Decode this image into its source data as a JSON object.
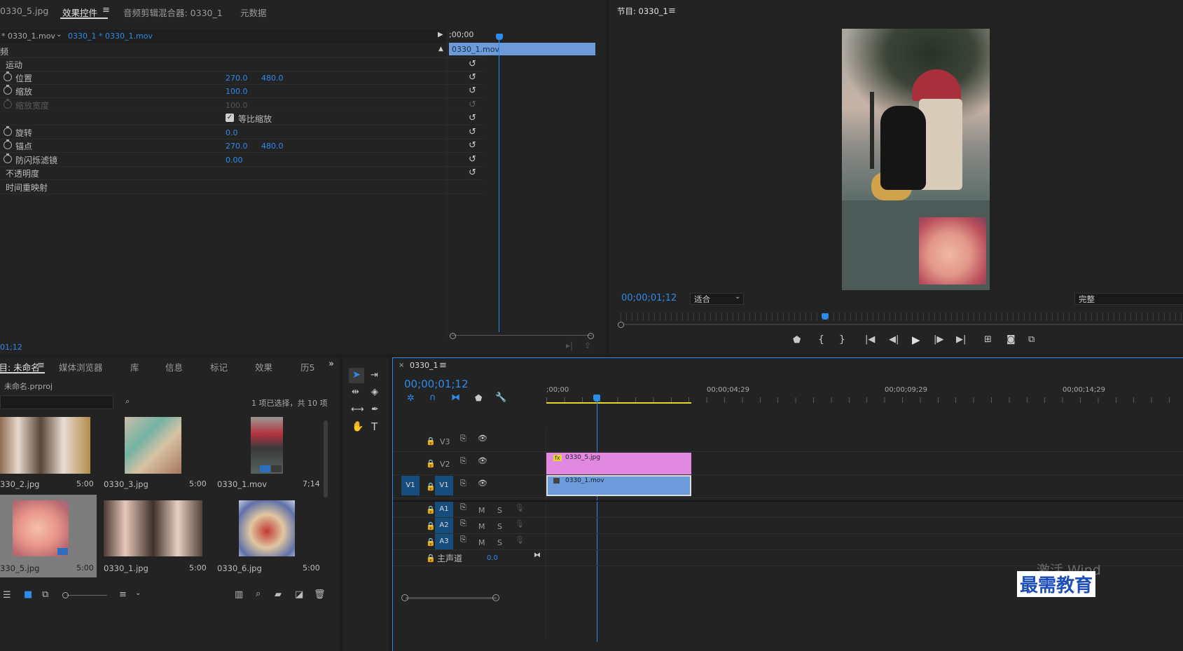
{
  "effects_panel": {
    "tabs": [
      "0330_5.jpg",
      "效果控件",
      "音频剪辑混合器: 0330_1",
      "元数据"
    ],
    "source_label": "* 0330_1.mov",
    "clip_label": "0330_1 * 0330_1.mov",
    "timecode_start": ";00;00",
    "clip_bar_label": "0330_1.mov",
    "video_header": "频",
    "motion_label": "运动",
    "properties": [
      {
        "label": "位置",
        "v1": "270.0",
        "v2": "480.0"
      },
      {
        "label": "缩放",
        "v1": "100.0",
        "v2": ""
      },
      {
        "label": "缩放宽度",
        "v1": "100.0",
        "v2": ""
      },
      {
        "label": "等比缩放",
        "v1": "",
        "v2": ""
      },
      {
        "label": "旋转",
        "v1": "0.0",
        "v2": ""
      },
      {
        "label": "锚点",
        "v1": "270.0",
        "v2": "480.0"
      },
      {
        "label": "防闪烁滤镜",
        "v1": "0.00",
        "v2": ""
      }
    ],
    "opacity_label": "不透明度",
    "time_remap_label": "时间重映射",
    "bottom_time": "01;12"
  },
  "program_monitor": {
    "title": "节目: 0330_1",
    "timecode": "00;00;01;12",
    "zoom": "适合",
    "quality": "完整"
  },
  "project_panel": {
    "tabs": [
      "项目: 未命名",
      "媒体浏览器",
      "库",
      "信息",
      "标记",
      "效果",
      "历5"
    ],
    "project_file": "未命名.prproj",
    "selection_status": "1 项已选择，共 10 项",
    "items": [
      {
        "name": "330_2.jpg",
        "duration": "5:00"
      },
      {
        "name": "0330_3.jpg",
        "duration": "5:00"
      },
      {
        "name": "0330_1.mov",
        "duration": "7;14"
      },
      {
        "name": "330_5.jpg",
        "duration": "5:00"
      },
      {
        "name": "0330_1.jpg",
        "duration": "5:00"
      },
      {
        "name": "0330_6.jpg",
        "duration": "5:00"
      }
    ]
  },
  "timeline": {
    "sequence_name": "0330_1",
    "timecode": "00;00;01;12",
    "ruler": [
      ";00;00",
      "00;00;04;29",
      "00;00;09;29",
      "00;00;14;29"
    ],
    "tracks": {
      "v3": "V3",
      "v2": "V2",
      "v1": "V1",
      "src_v1": "V1",
      "a1": "A1",
      "a2": "A2",
      "a3": "A3",
      "m": "M",
      "s": "S",
      "master_label": "主声道",
      "master_value": "0.0"
    },
    "clip_v2": "0330_5.jpg",
    "clip_v1": "0330_1.mov",
    "fx_badge": "fx"
  },
  "watermark": {
    "activate": "激活 Wind",
    "brand": "最需教育"
  }
}
